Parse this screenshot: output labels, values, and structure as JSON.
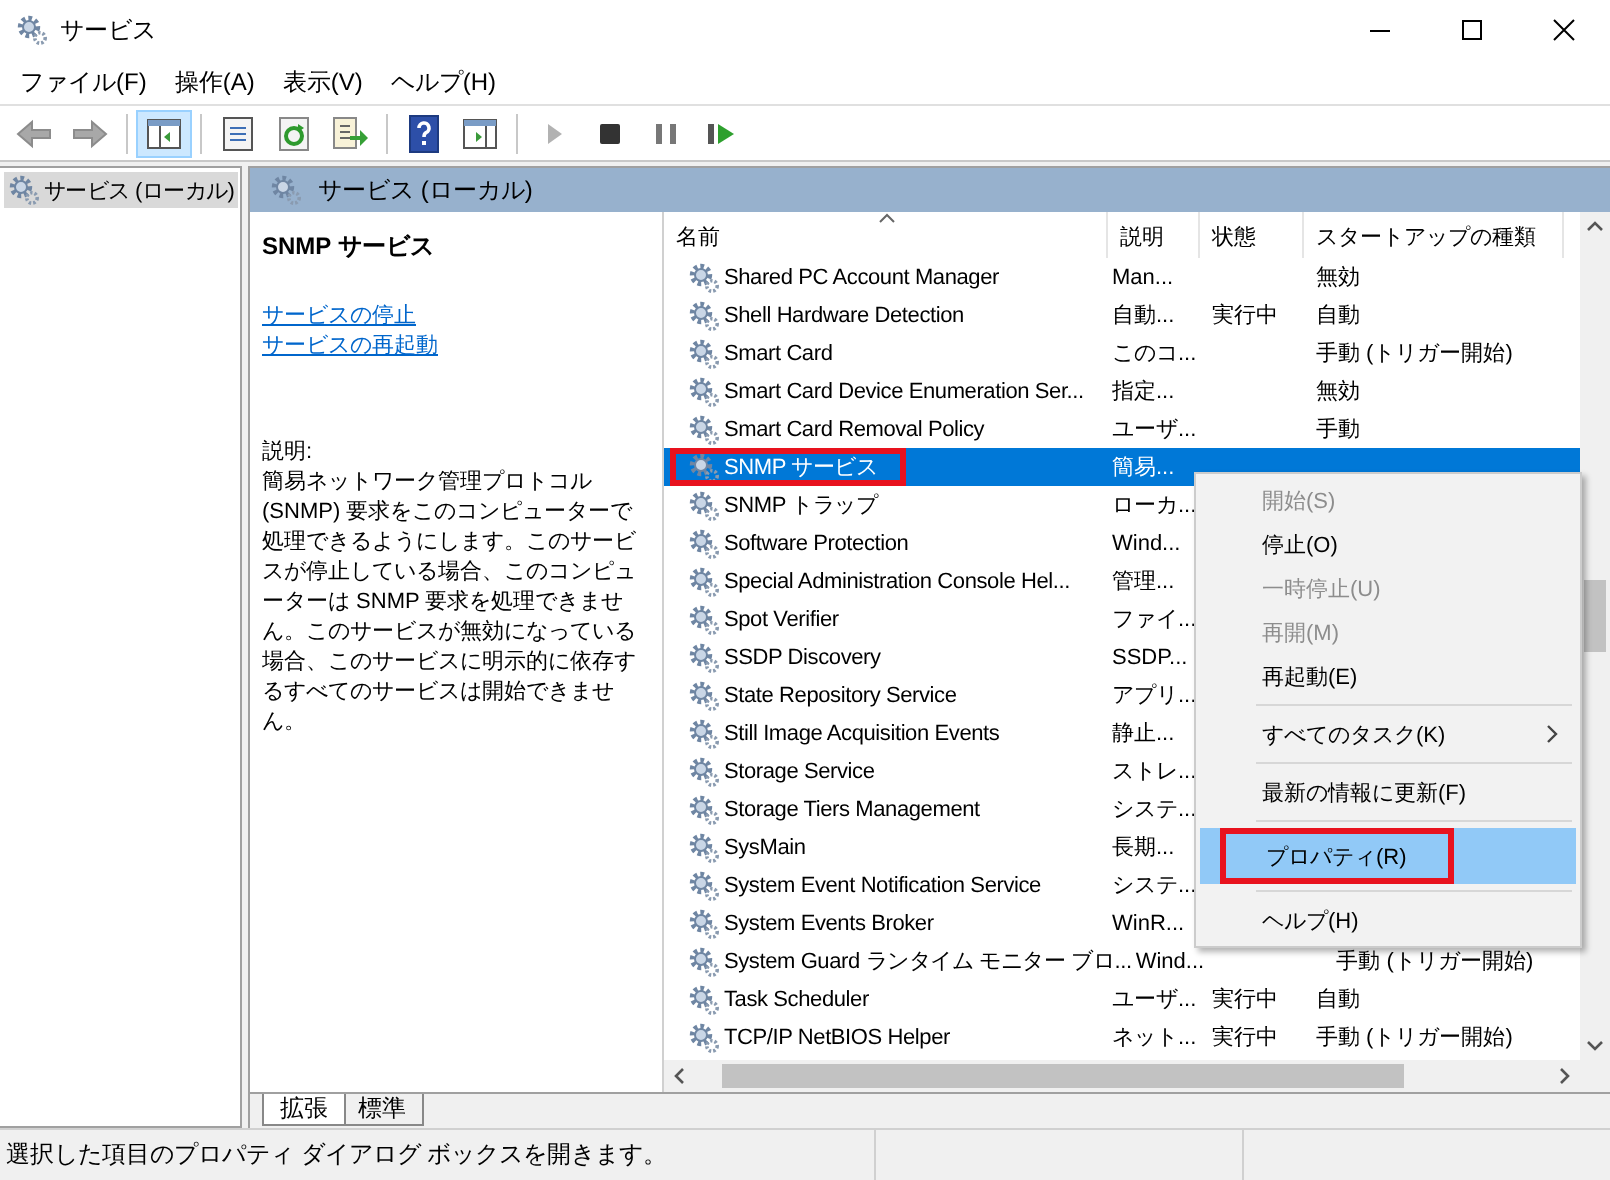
{
  "window": {
    "title": "サービス"
  },
  "menu_bar": [
    {
      "label": "ファイル(F)"
    },
    {
      "label": "操作(A)"
    },
    {
      "label": "表示(V)"
    },
    {
      "label": "ヘルプ(H)"
    }
  ],
  "toolbar": [
    [
      {
        "kind": "back",
        "disabled": true,
        "pressed": false
      },
      {
        "kind": "forward",
        "disabled": true,
        "pressed": false
      }
    ],
    [
      {
        "kind": "tree",
        "disabled": false,
        "pressed": true
      }
    ],
    [
      {
        "kind": "properties",
        "disabled": false,
        "pressed": false
      },
      {
        "kind": "refresh",
        "disabled": false,
        "pressed": false
      },
      {
        "kind": "export",
        "disabled": false,
        "pressed": false
      }
    ],
    [
      {
        "kind": "help",
        "disabled": false,
        "pressed": false
      },
      {
        "kind": "console",
        "disabled": false,
        "pressed": false
      }
    ],
    [
      {
        "kind": "play",
        "disabled": true,
        "pressed": false
      },
      {
        "kind": "stop",
        "disabled": false,
        "pressed": false
      },
      {
        "kind": "pause",
        "disabled": false,
        "pressed": false
      },
      {
        "kind": "restart",
        "disabled": false,
        "pressed": false
      }
    ]
  ],
  "tree": {
    "items": [
      {
        "label": "サービス (ローカル)",
        "selected": true
      }
    ]
  },
  "pane": {
    "title": "サービス (ローカル)"
  },
  "details": {
    "service_name": "SNMP サービス",
    "links": [
      "サービスの停止",
      "サービスの再起動"
    ],
    "description_label": "説明:",
    "description": "簡易ネットワーク管理プロトコル (SNMP) 要求をこのコンピューターで処理できるようにします。このサービスが停止している場合、このコンピューターは SNMP 要求を処理できません。このサービスが無効になっている場合、このサービスに明示的に依存するすべてのサービスは開始できません。"
  },
  "list": {
    "columns": [
      {
        "label": "名前",
        "sorted": true
      },
      {
        "label": "説明",
        "sorted": false
      },
      {
        "label": "状態",
        "sorted": false
      },
      {
        "label": "スタートアップの種類",
        "sorted": false
      }
    ],
    "rows": [
      {
        "name": "Shared PC Account Manager",
        "description": "Man...",
        "status": "",
        "startup": "無効",
        "selected": false,
        "annotated": false
      },
      {
        "name": "Shell Hardware Detection",
        "description": "自動...",
        "status": "実行中",
        "startup": "自動",
        "selected": false,
        "annotated": false
      },
      {
        "name": "Smart Card",
        "description": "このコ...",
        "status": "",
        "startup": "手動 (トリガー開始)",
        "selected": false,
        "annotated": false
      },
      {
        "name": "Smart Card Device Enumeration Ser...",
        "description": "指定...",
        "status": "",
        "startup": "無効",
        "selected": false,
        "annotated": false
      },
      {
        "name": "Smart Card Removal Policy",
        "description": "ユーザ...",
        "status": "",
        "startup": "手動",
        "selected": false,
        "annotated": false
      },
      {
        "name": "SNMP サービス",
        "description": "簡易...",
        "status": "",
        "startup": "",
        "selected": true,
        "annotated": true
      },
      {
        "name": "SNMP トラップ",
        "description": "ローカ...",
        "status": "",
        "startup": "",
        "selected": false,
        "annotated": false
      },
      {
        "name": "Software Protection",
        "description": "Wind...",
        "status": "",
        "startup": "",
        "selected": false,
        "annotated": false
      },
      {
        "name": "Special Administration Console Hel...",
        "description": "管理...",
        "status": "",
        "startup": "",
        "selected": false,
        "annotated": false
      },
      {
        "name": "Spot Verifier",
        "description": "ファイ...",
        "status": "",
        "startup": "",
        "selected": false,
        "annotated": false
      },
      {
        "name": "SSDP Discovery",
        "description": "SSDP...",
        "status": "",
        "startup": "",
        "selected": false,
        "annotated": false
      },
      {
        "name": "State Repository Service",
        "description": "アプリ...",
        "status": "",
        "startup": "",
        "selected": false,
        "annotated": false
      },
      {
        "name": "Still Image Acquisition Events",
        "description": "静止...",
        "status": "",
        "startup": "",
        "selected": false,
        "annotated": false
      },
      {
        "name": "Storage Service",
        "description": "ストレ...",
        "status": "",
        "startup": "",
        "selected": false,
        "annotated": false
      },
      {
        "name": "Storage Tiers Management",
        "description": "システ...",
        "status": "",
        "startup": "",
        "selected": false,
        "annotated": false
      },
      {
        "name": "SysMain",
        "description": "長期...",
        "status": "",
        "startup": "",
        "selected": false,
        "annotated": false
      },
      {
        "name": "System Event Notification Service",
        "description": "システ...",
        "status": "",
        "startup": "",
        "selected": false,
        "annotated": false
      },
      {
        "name": "System Events Broker",
        "description": "WinR...",
        "status": "",
        "startup": "",
        "selected": false,
        "annotated": false
      },
      {
        "name": "System Guard ランタイム モニター ブロ...",
        "description": "Wind...",
        "status": "",
        "startup": "手動 (トリガー開始)",
        "selected": false,
        "annotated": false
      },
      {
        "name": "Task Scheduler",
        "description": "ユーザ...",
        "status": "実行中",
        "startup": "自動",
        "selected": false,
        "annotated": false
      },
      {
        "name": "TCP/IP NetBIOS Helper",
        "description": "ネット...",
        "status": "実行中",
        "startup": "手動 (トリガー開始)",
        "selected": false,
        "annotated": false
      }
    ]
  },
  "context_menu": {
    "items": [
      {
        "label": "開始(S)",
        "disabled": true,
        "selected": false,
        "annotated": false,
        "has_submenu": false,
        "separator_after": false
      },
      {
        "label": "停止(O)",
        "disabled": false,
        "selected": false,
        "annotated": false,
        "has_submenu": false,
        "separator_after": false
      },
      {
        "label": "一時停止(U)",
        "disabled": true,
        "selected": false,
        "annotated": false,
        "has_submenu": false,
        "separator_after": false
      },
      {
        "label": "再開(M)",
        "disabled": true,
        "selected": false,
        "annotated": false,
        "has_submenu": false,
        "separator_after": false
      },
      {
        "label": "再起動(E)",
        "disabled": false,
        "selected": false,
        "annotated": false,
        "has_submenu": false,
        "separator_after": true
      },
      {
        "label": "すべてのタスク(K)",
        "disabled": false,
        "selected": false,
        "annotated": false,
        "has_submenu": true,
        "separator_after": true
      },
      {
        "label": "最新の情報に更新(F)",
        "disabled": false,
        "selected": false,
        "annotated": false,
        "has_submenu": false,
        "separator_after": true
      },
      {
        "label": "プロパティ(R)",
        "disabled": false,
        "selected": true,
        "annotated": true,
        "has_submenu": false,
        "separator_after": true
      },
      {
        "label": "ヘルプ(H)",
        "disabled": false,
        "selected": false,
        "annotated": false,
        "has_submenu": false,
        "separator_after": false
      }
    ]
  },
  "view_tabs": [
    {
      "label": "拡張",
      "selected": true
    },
    {
      "label": "標準",
      "selected": false
    }
  ],
  "status_bar": {
    "text": "選択した項目のプロパティ ダイアログ ボックスを開きます。"
  }
}
